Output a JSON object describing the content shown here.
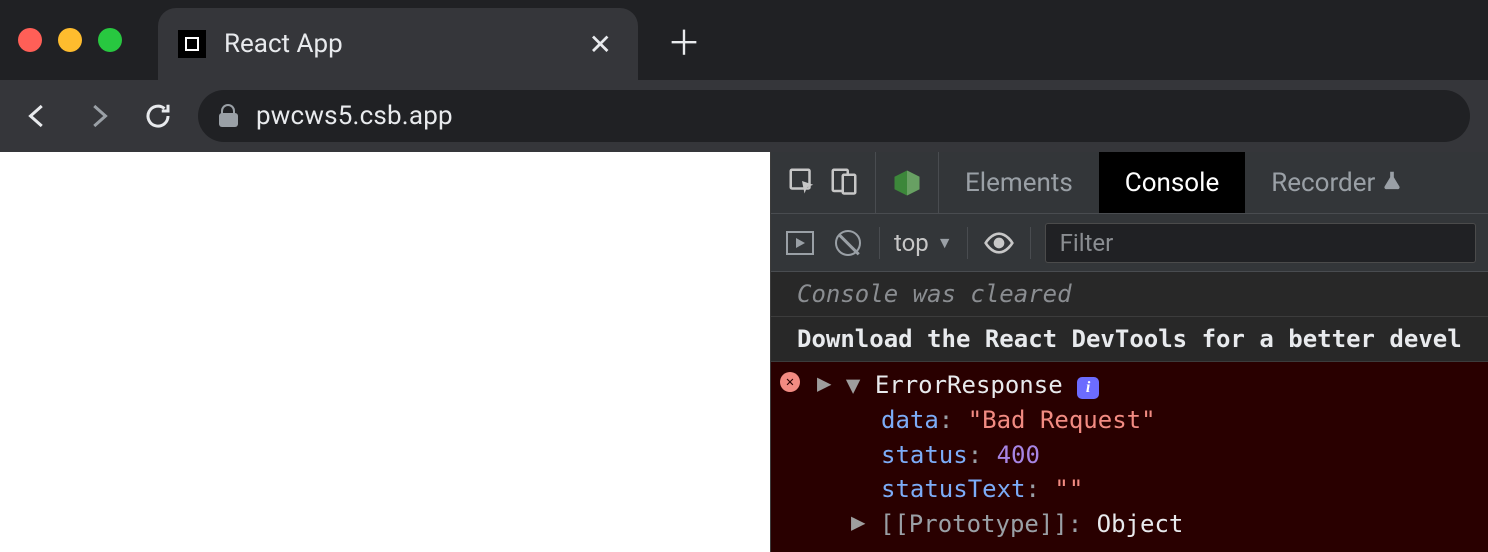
{
  "tab": {
    "title": "React App"
  },
  "url": "pwcws5.csb.app",
  "devtools": {
    "tabs": {
      "elements": "Elements",
      "console": "Console",
      "recorder": "Recorder"
    },
    "console_toolbar": {
      "context": "top",
      "filter_placeholder": "Filter"
    },
    "console": {
      "cleared": "Console was cleared",
      "react_devtools_msg": "Download the React DevTools for a better devel",
      "error": {
        "name": "ErrorResponse",
        "props": {
          "data_key": "data",
          "data_val": "\"Bad Request\"",
          "status_key": "status",
          "status_val": "400",
          "statusText_key": "statusText",
          "statusText_val": "\"\"",
          "proto_key": "[[Prototype]]",
          "proto_val": "Object"
        }
      }
    }
  }
}
